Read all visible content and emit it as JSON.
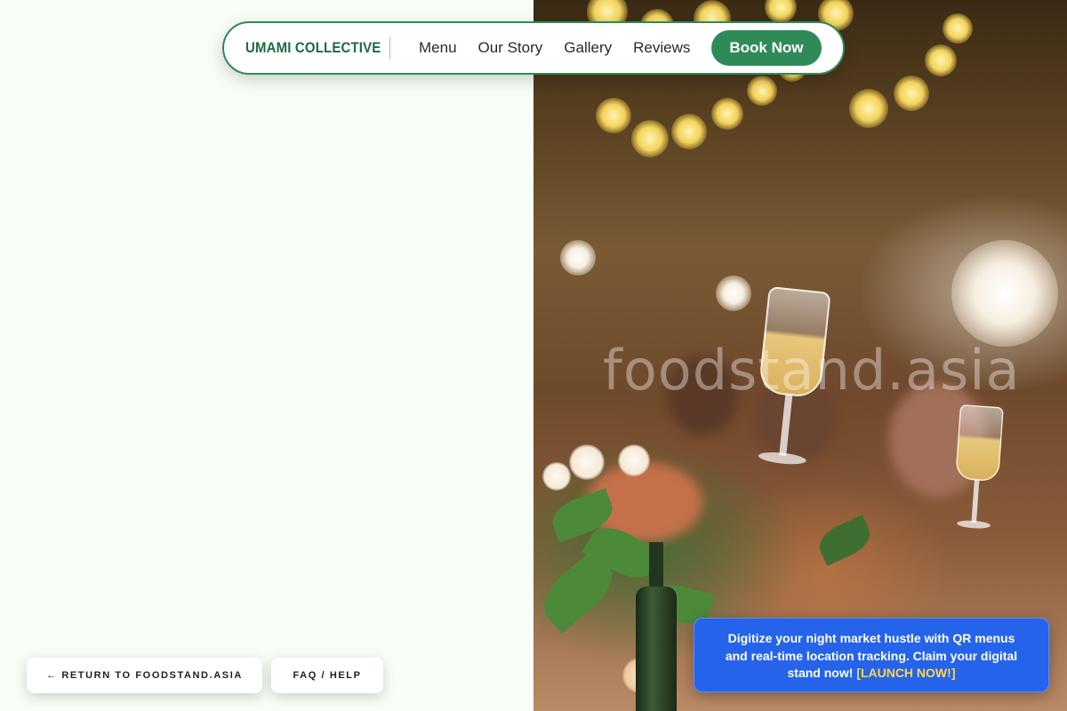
{
  "nav": {
    "brand": "UMAMI COLLECTIVE",
    "links": [
      "Menu",
      "Our Story",
      "Gallery",
      "Reviews"
    ],
    "cta": "Book Now"
  },
  "hero": {
    "watermark": "foodstand.asia",
    "image": "celebration-toast-photo"
  },
  "footer": {
    "return_label": "← RETURN TO FOODSTAND.ASIA",
    "faq_label": "FAQ / HELP"
  },
  "promo": {
    "text": "Digitize your night market hustle with QR menus and real-time location tracking. Claim your digital stand now!",
    "cta": "[LAUNCH NOW!]"
  },
  "colors": {
    "brand_green": "#2e8b57",
    "page_bg": "#f8fdf6",
    "promo_blue": "#2563eb",
    "promo_cta": "#ffd84a"
  }
}
